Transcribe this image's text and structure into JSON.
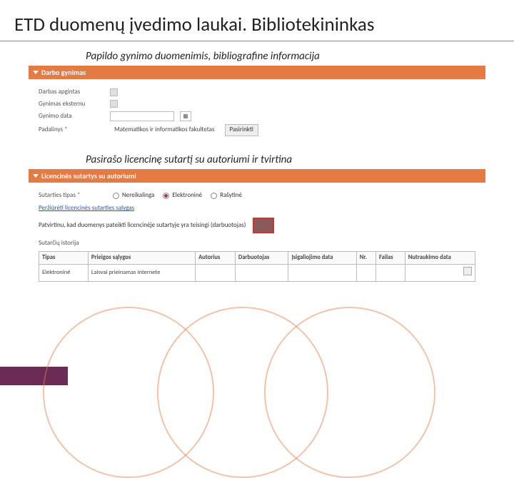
{
  "page": {
    "title": "ETD duomenų įvedimo laukai. Bibliotekininkas"
  },
  "section1": {
    "caption": "Papildo gynimo duomenimis, bibliografine informacija",
    "bar_title": "Darbo gynimas",
    "fields": {
      "apgintas": "Darbas apgintas",
      "eksternu": "Gynimas eksternu",
      "data": "Gynimo data",
      "padalinys": "Padalinys *",
      "padalinys_value": "Matematikos ir informatikos fakultetas",
      "pasirinkti": "Pasirinkti"
    }
  },
  "section2": {
    "caption": "Pasirašo licencinę sutartį su autoriumi ir tvirtina",
    "bar_title": "Licencinės sutartys su autoriumi",
    "contract_type_label": "Sutarties tipas *",
    "radios": {
      "nereikalinga": "Nereikalinga",
      "elektronine": "Elektroninė",
      "rasytine": "Rašytinė"
    },
    "link_text": "Peržiūrėti licencinės sutarties sąlygas",
    "ack_prefix": "Patvirtinu, kad duomenys pateikti licencinėje sutartyje yra teisingi (darbuotojas)",
    "history_label": "Sutarčių istorija",
    "table": {
      "headers": {
        "tipas": "Tipas",
        "salygos": "Prieigos sąlygos",
        "autorius": "Autorius",
        "darbuotojas": "Darbuotojas",
        "galioja": "Įsigaliojimo data",
        "nr": "Nr.",
        "failas": "Failas",
        "nutraukimas": "Nutraukimo data"
      },
      "row": {
        "tipas": "Elektroninė",
        "salygos": "Laisvai prieinamas internete"
      }
    }
  }
}
